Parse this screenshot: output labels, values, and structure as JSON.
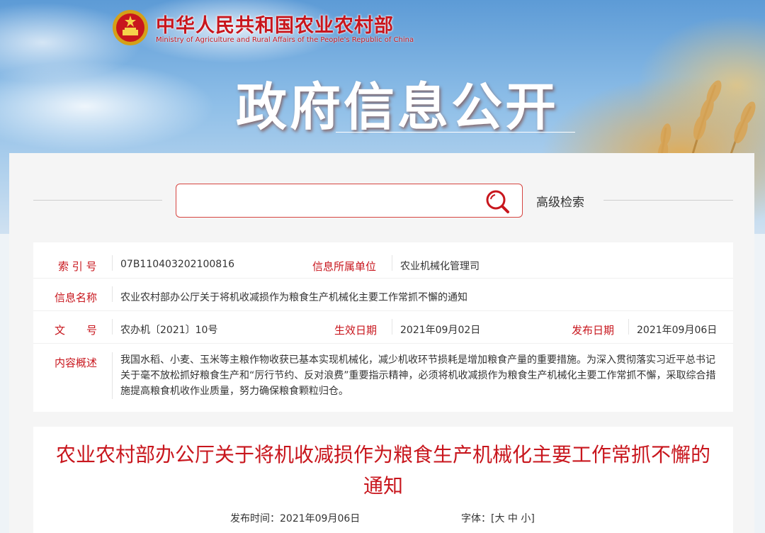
{
  "header": {
    "ministry_cn": "中华人民共和国农业农村部",
    "ministry_en": "Ministry of Agriculture and Rural Affairs of the People's Republic of China",
    "section_title": "政府信息公开"
  },
  "search": {
    "placeholder": "",
    "advanced_label": "高级检索"
  },
  "info": {
    "index_label": "索 引 号",
    "index_value": "07B110403202100816",
    "unit_label": "信息所属单位",
    "unit_value": "农业机械化管理司",
    "name_label": "信息名称",
    "name_value": "农业农村部办公厅关于将机收减损作为粮食生产机械化主要工作常抓不懈的通知",
    "doc_label": "文　　号",
    "doc_value": "农办机〔2021〕10号",
    "effective_label": "生效日期",
    "effective_value": "2021年09月02日",
    "publish_label": "发布日期",
    "publish_value": "2021年09月06日",
    "summary_label": "内容概述",
    "summary_value": "我国水稻、小麦、玉米等主粮作物收获已基本实现机械化，减少机收环节损耗是增加粮食产量的重要措施。为深入贯彻落实习近平总书记关于毫不放松抓好粮食生产和“厉行节约、反对浪费”重要指示精神，必须将机收减损作为粮食生产机械化主要工作常抓不懈，采取综合措施提高粮食机收作业质量，努力确保粮食颗粒归仓。"
  },
  "article": {
    "title": "农业农村部办公厅关于将机收减损作为粮食生产机械化主要工作常抓不懈的通知",
    "pubtime_label": "发布时间：",
    "pubtime_value": "2021年09月06日",
    "fontsize_label": "字体：",
    "fontsize_open": "[",
    "fontsize_large": "大",
    "fontsize_medium": "中",
    "fontsize_small": "小",
    "fontsize_close": "]"
  },
  "colors": {
    "accent": "#c8161d",
    "search_border": "#d64541"
  }
}
